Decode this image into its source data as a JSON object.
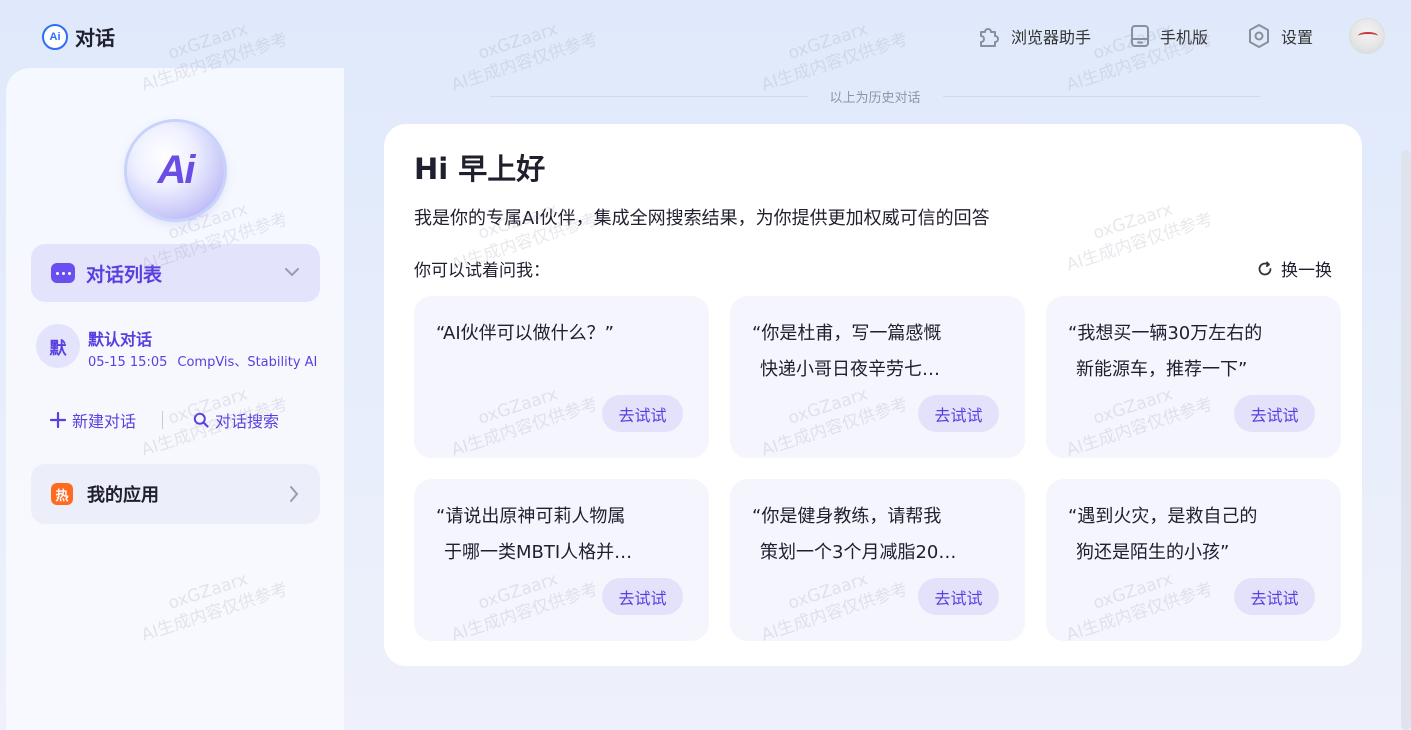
{
  "header": {
    "brand_logo": "Ai",
    "brand_title": "对话",
    "actions": [
      {
        "label": "浏览器助手",
        "icon": "puzzle-icon"
      },
      {
        "label": "手机版",
        "icon": "phone-icon"
      },
      {
        "label": "设置",
        "icon": "gear-icon"
      }
    ]
  },
  "sidebar": {
    "logo_text": "Ai",
    "conversation_list_title": "对话列表",
    "conversation": {
      "avatar_char": "默",
      "title": "默认对话",
      "date": "05-15 15:05",
      "preview": "CompVis、Stability AI"
    },
    "new_chat_label": "新建对话",
    "search_chat_label": "对话搜索",
    "hot_badge": "热",
    "my_apps_label": "我的应用"
  },
  "main": {
    "history_divider": "以上为历史对话",
    "greeting": "Hi 早上好",
    "subtitle": "我是你的专属AI伙伴，集成全网搜索结果，为你提供更加权威可信的回答",
    "try_label": "你可以试着问我：",
    "refresh_label": "换一换",
    "try_button": "去试试",
    "questions": [
      {
        "line1": "“AI伙伴可以做什么？”",
        "line2": ""
      },
      {
        "line1": "“你是杜甫，写一篇感慨",
        "line2": "快递小哥日夜辛劳七…"
      },
      {
        "line1": "“我想买一辆30万左右的",
        "line2": "新能源车，推荐一下”"
      },
      {
        "line1": "“请说出原神可莉人物属",
        "line2": "于哪一类MBTI人格并…"
      },
      {
        "line1": "“你是健身教练，请帮我",
        "line2": "策划一个3个月减脂20…"
      },
      {
        "line1": "“遇到火灾，是救自己的",
        "line2": "狗还是陌生的小孩”"
      }
    ]
  },
  "watermark": {
    "line1": "oxGZaarx",
    "line2": "AI生成内容仅供参考"
  },
  "colors": {
    "accent": "#5a3fe0",
    "hot": "#ff6a1f",
    "brand_blue": "#2f6df6"
  }
}
